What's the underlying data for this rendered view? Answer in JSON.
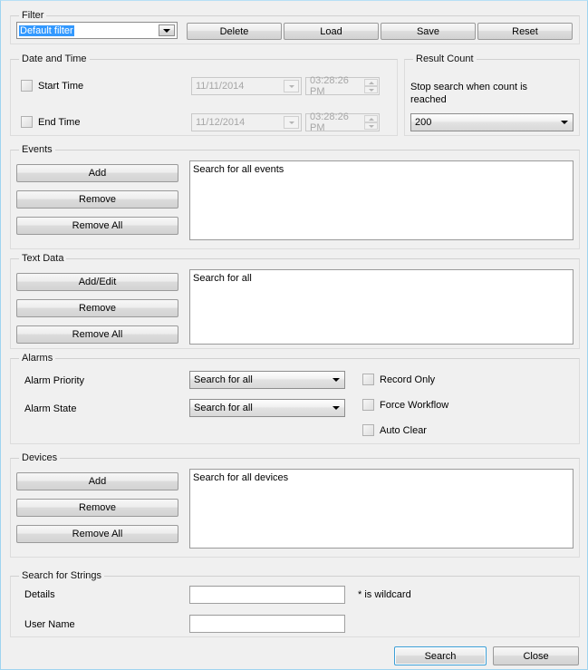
{
  "filter": {
    "legend": "Filter",
    "combo_value": "Default filter",
    "buttons": [
      {
        "label": "Delete",
        "name": "delete-filter-button"
      },
      {
        "label": "Load",
        "name": "load-filter-button"
      },
      {
        "label": "Save",
        "name": "save-filter-button"
      },
      {
        "label": "Reset",
        "name": "reset-filter-button"
      }
    ]
  },
  "date_and_time": {
    "legend": "Date and Time",
    "start": {
      "checkbox_label": "Start Time",
      "checked": false,
      "date": "11/11/2014",
      "time": "03:28:26 PM"
    },
    "end": {
      "checkbox_label": "End Time",
      "checked": false,
      "date": "11/12/2014",
      "time": "03:28:26 PM"
    }
  },
  "result_count": {
    "legend": "Result Count",
    "description": "Stop search when count is reached",
    "value": "200"
  },
  "events": {
    "legend": "Events",
    "buttons": [
      {
        "label": "Add",
        "name": "events-add-button"
      },
      {
        "label": "Remove",
        "name": "events-remove-button"
      },
      {
        "label": "Remove All",
        "name": "events-remove-all-button"
      }
    ],
    "list_items": [
      "Search for all events"
    ]
  },
  "text_data": {
    "legend": "Text Data",
    "buttons": [
      {
        "label": "Add/Edit",
        "name": "textdata-add-edit-button"
      },
      {
        "label": "Remove",
        "name": "textdata-remove-button"
      },
      {
        "label": "Remove All",
        "name": "textdata-remove-all-button"
      }
    ],
    "list_items": [
      "Search for all"
    ]
  },
  "alarms": {
    "legend": "Alarms",
    "priority_label": "Alarm Priority",
    "priority_value": "Search for all",
    "state_label": "Alarm State",
    "state_value": "Search for all",
    "checkboxes": [
      {
        "label": "Record Only",
        "checked": false,
        "name": "record-only-checkbox"
      },
      {
        "label": "Force Workflow",
        "checked": false,
        "name": "force-workflow-checkbox"
      },
      {
        "label": "Auto Clear",
        "checked": false,
        "name": "auto-clear-checkbox"
      }
    ]
  },
  "devices": {
    "legend": "Devices",
    "buttons": [
      {
        "label": "Add",
        "name": "devices-add-button"
      },
      {
        "label": "Remove",
        "name": "devices-remove-button"
      },
      {
        "label": "Remove All",
        "name": "devices-remove-all-button"
      }
    ],
    "list_items": [
      "Search for all devices"
    ]
  },
  "search_for_strings": {
    "legend": "Search for Strings",
    "details_label": "Details",
    "details_value": "",
    "details_placeholder": "",
    "username_label": "User Name",
    "username_value": "",
    "username_placeholder": "",
    "wildcard_hint": "* is wildcard"
  },
  "footer": {
    "search_label": "Search",
    "close_label": "Close"
  },
  "colors": {
    "window_border": "#9fd4f0",
    "selection": "#3399ff",
    "focus_border": "#3c9fd6",
    "surface": "#f0f0f0",
    "disabled_text": "#a6a6a6"
  }
}
